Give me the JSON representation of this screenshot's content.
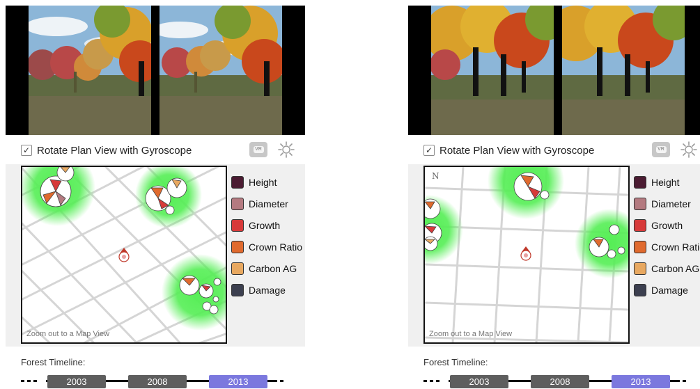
{
  "panels": [
    {
      "id": "left",
      "gyroscope_checkbox": {
        "checked": true,
        "mark": "✓",
        "label": "Rotate Plan View with Gyroscope"
      },
      "vr_button": {
        "icon": "vr-headset-icon",
        "text": "VR"
      },
      "brightness_button": {
        "icon": "sun-icon"
      },
      "show_compass": false,
      "compass_text": "",
      "map_link": "Zoom out to a Map View",
      "legend": [
        {
          "label": "Height",
          "color": "#4b1c32"
        },
        {
          "label": "Diameter",
          "color": "#b47a80"
        },
        {
          "label": "Growth",
          "color": "#d73a3a"
        },
        {
          "label": "Crown Ratio",
          "color": "#e06a2e"
        },
        {
          "label": "Carbon AG",
          "color": "#e8a860"
        },
        {
          "label": "Damage",
          "color": "#3c3f4f"
        }
      ],
      "timeline": {
        "title": "Forest Timeline:",
        "years": [
          {
            "label": "2003",
            "selected": false
          },
          {
            "label": "2008",
            "selected": false
          },
          {
            "label": "2013",
            "selected": true
          }
        ]
      }
    },
    {
      "id": "right",
      "gyroscope_checkbox": {
        "checked": true,
        "mark": "✓",
        "label": "Rotate Plan View with Gyroscope"
      },
      "vr_button": {
        "icon": "vr-headset-icon",
        "text": "VR"
      },
      "brightness_button": {
        "icon": "sun-icon"
      },
      "show_compass": true,
      "compass_text": "N",
      "map_link": "Zoom out to a Map View",
      "legend": [
        {
          "label": "Height",
          "color": "#4b1c32"
        },
        {
          "label": "Diameter",
          "color": "#b47a80"
        },
        {
          "label": "Growth",
          "color": "#d73a3a"
        },
        {
          "label": "Crown Ratio",
          "color": "#e06a2e"
        },
        {
          "label": "Carbon AG",
          "color": "#e8a860"
        },
        {
          "label": "Damage",
          "color": "#3c3f4f"
        }
      ],
      "timeline": {
        "title": "Forest Timeline:",
        "years": [
          {
            "label": "2003",
            "selected": false
          },
          {
            "label": "2008",
            "selected": false
          },
          {
            "label": "2013",
            "selected": true
          }
        ]
      }
    }
  ],
  "colors": {
    "year_default": "#5e5e5e",
    "year_selected": "#7b78de",
    "footprint_glow": "#55ee55",
    "user_marker": "#c0392b"
  }
}
